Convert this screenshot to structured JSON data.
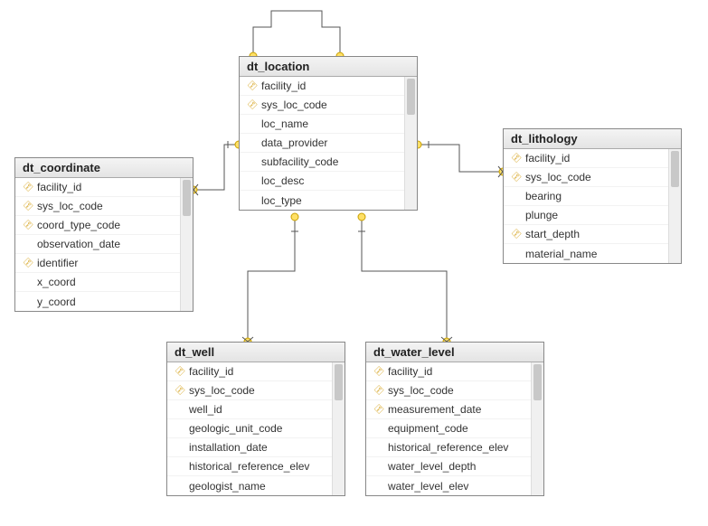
{
  "diagram": {
    "entities": {
      "dt_location": {
        "title": "dt_location",
        "columns": [
          {
            "name": "facility_id",
            "pk": true
          },
          {
            "name": "sys_loc_code",
            "pk": true
          },
          {
            "name": "loc_name",
            "pk": false
          },
          {
            "name": "data_provider",
            "pk": false
          },
          {
            "name": "subfacility_code",
            "pk": false
          },
          {
            "name": "loc_desc",
            "pk": false
          },
          {
            "name": "loc_type",
            "pk": false
          }
        ]
      },
      "dt_coordinate": {
        "title": "dt_coordinate",
        "columns": [
          {
            "name": "facility_id",
            "pk": true
          },
          {
            "name": "sys_loc_code",
            "pk": true
          },
          {
            "name": "coord_type_code",
            "pk": true
          },
          {
            "name": "observation_date",
            "pk": false
          },
          {
            "name": "identifier",
            "pk": true
          },
          {
            "name": "x_coord",
            "pk": false
          },
          {
            "name": "y_coord",
            "pk": false
          }
        ]
      },
      "dt_lithology": {
        "title": "dt_lithology",
        "columns": [
          {
            "name": "facility_id",
            "pk": true
          },
          {
            "name": "sys_loc_code",
            "pk": true
          },
          {
            "name": "bearing",
            "pk": false
          },
          {
            "name": "plunge",
            "pk": false
          },
          {
            "name": "start_depth",
            "pk": true
          },
          {
            "name": "material_name",
            "pk": false
          }
        ]
      },
      "dt_well": {
        "title": "dt_well",
        "columns": [
          {
            "name": "facility_id",
            "pk": true
          },
          {
            "name": "sys_loc_code",
            "pk": true
          },
          {
            "name": "well_id",
            "pk": false
          },
          {
            "name": "geologic_unit_code",
            "pk": false
          },
          {
            "name": "installation_date",
            "pk": false
          },
          {
            "name": "historical_reference_elev",
            "pk": false
          },
          {
            "name": "geologist_name",
            "pk": false
          }
        ]
      },
      "dt_water_level": {
        "title": "dt_water_level",
        "columns": [
          {
            "name": "facility_id",
            "pk": true
          },
          {
            "name": "sys_loc_code",
            "pk": true
          },
          {
            "name": "measurement_date",
            "pk": true
          },
          {
            "name": "equipment_code",
            "pk": false
          },
          {
            "name": "historical_reference_elev",
            "pk": false
          },
          {
            "name": "water_level_depth",
            "pk": false
          },
          {
            "name": "water_level_elev",
            "pk": false
          }
        ]
      }
    },
    "relationships": [
      {
        "from": "dt_location",
        "to": "dt_location",
        "type": "self"
      },
      {
        "from": "dt_location",
        "to": "dt_coordinate",
        "type": "one-to-many"
      },
      {
        "from": "dt_location",
        "to": "dt_lithology",
        "type": "one-to-many"
      },
      {
        "from": "dt_location",
        "to": "dt_well",
        "type": "one-to-many"
      },
      {
        "from": "dt_location",
        "to": "dt_water_level",
        "type": "one-to-many"
      }
    ]
  }
}
